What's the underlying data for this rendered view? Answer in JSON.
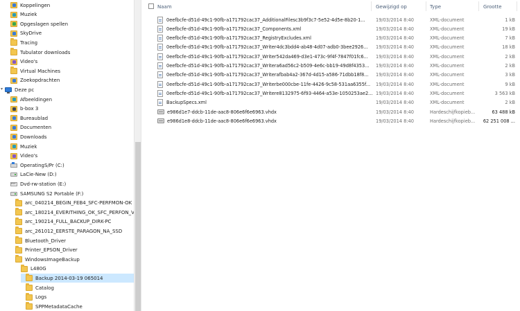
{
  "navigation": {
    "items": [
      {
        "label": "Koppelingen",
        "icon": "links-folder-icon",
        "kind": "special",
        "tint": ""
      },
      {
        "label": "Muziek",
        "icon": "music-folder-icon",
        "kind": "special",
        "tint": "ic-teal"
      },
      {
        "label": "Opgeslagen spellen",
        "icon": "saved-games-folder-icon",
        "kind": "special",
        "tint": "ic-green"
      },
      {
        "label": "SkyDrive",
        "icon": "skydrive-folder-icon",
        "kind": "special",
        "tint": ""
      },
      {
        "label": "Tracing",
        "icon": "folder-icon",
        "kind": "folder",
        "tint": ""
      },
      {
        "label": "Tubulator downloads",
        "icon": "folder-icon",
        "kind": "folder",
        "tint": ""
      },
      {
        "label": "Video's",
        "icon": "videos-folder-icon",
        "kind": "special",
        "tint": "ic-purple"
      },
      {
        "label": "Virtual Machines",
        "icon": "folder-icon",
        "kind": "folder",
        "tint": ""
      },
      {
        "label": "Zoekopdrachten",
        "icon": "searches-folder-icon",
        "kind": "special",
        "tint": ""
      },
      {
        "label": "Deze pc",
        "icon": "this-pc-icon",
        "kind": "pc",
        "tint": ""
      },
      {
        "label": "Afbeeldingen",
        "icon": "pictures-folder-icon",
        "kind": "special",
        "tint": "ic-teal"
      },
      {
        "label": "b-box 3",
        "icon": "network-folder-icon",
        "kind": "special",
        "tint": "ic-dark"
      },
      {
        "label": "Bureaublad",
        "icon": "desktop-folder-icon",
        "kind": "special",
        "tint": ""
      },
      {
        "label": "Documenten",
        "icon": "documents-folder-icon",
        "kind": "special",
        "tint": ""
      },
      {
        "label": "Downloads",
        "icon": "downloads-folder-icon",
        "kind": "special",
        "tint": ""
      },
      {
        "label": "Muziek",
        "icon": "music-folder-icon",
        "kind": "special",
        "tint": "ic-teal"
      },
      {
        "label": "Video's",
        "icon": "videos-folder-icon",
        "kind": "special",
        "tint": "ic-purple"
      },
      {
        "label": "OperatingS/Pr (C:)",
        "icon": "windows-drive-icon",
        "kind": "win",
        "tint": ""
      },
      {
        "label": "LaCie-New (D:)",
        "icon": "drive-icon",
        "kind": "drive",
        "tint": ""
      },
      {
        "label": "Dvd-rw-station (E:)",
        "icon": "dvd-drive-icon",
        "kind": "dvd",
        "tint": ""
      },
      {
        "label": "SAMSUNG S2 Portable (F:)",
        "icon": "drive-icon",
        "kind": "drive",
        "tint": ""
      },
      {
        "label": "arc_040214_BEGIN_FEB4_SFC-PERFMON-OK",
        "icon": "folder-icon",
        "kind": "folder",
        "tint": ""
      },
      {
        "label": "arc_180214_EVERITHING_OK_SFC_PERFON_VIR",
        "icon": "folder-icon",
        "kind": "folder",
        "tint": ""
      },
      {
        "label": "arc_190214_FULL_BACKUP_DIRK-PC",
        "icon": "folder-icon",
        "kind": "folder",
        "tint": ""
      },
      {
        "label": "arc_261012_EERSTE_PARAGON_NA_SSD",
        "icon": "folder-icon",
        "kind": "folder",
        "tint": ""
      },
      {
        "label": "Bluetooth_Driver",
        "icon": "folder-icon",
        "kind": "folder",
        "tint": ""
      },
      {
        "label": "Printer_EPSON_Driver",
        "icon": "folder-icon",
        "kind": "folder",
        "tint": ""
      },
      {
        "label": "WindowsImageBackup",
        "icon": "folder-icon",
        "kind": "folder",
        "tint": ""
      },
      {
        "label": "L480G",
        "icon": "folder-icon",
        "kind": "folder",
        "tint": ""
      },
      {
        "label": "Backup 2014-03-19 065014",
        "icon": "folder-icon",
        "kind": "folder",
        "tint": "",
        "selected": true
      },
      {
        "label": "Catalog",
        "icon": "folder-icon",
        "kind": "folder",
        "tint": ""
      },
      {
        "label": "Logs",
        "icon": "folder-icon",
        "kind": "folder",
        "tint": ""
      },
      {
        "label": "SPPMetadataCache",
        "icon": "folder-icon",
        "kind": "folder",
        "tint": ""
      }
    ]
  },
  "file_list": {
    "columns": {
      "name": "Naam",
      "date": "Gewijzigd op",
      "type": "Type",
      "size": "Grootte"
    },
    "rows": [
      {
        "name": "0eefbcfe-d51d-49c1-90fb-a171792cac37_AdditionalFilesc3b9f3c7-5e52-4d5e-8b20-1...",
        "date": "19/03/2014 8:40",
        "type": "XML-document",
        "size": "1 kB",
        "icon": "xml-file-icon"
      },
      {
        "name": "0eefbcfe-d51d-49c1-90fb-a171792cac37_Components.xml",
        "date": "19/03/2014 8:40",
        "type": "XML-document",
        "size": "19 kB",
        "icon": "xml-file-icon"
      },
      {
        "name": "0eefbcfe-d51d-49c1-90fb-a171792cac37_RegistryExcludes.xml",
        "date": "19/03/2014 8:40",
        "type": "XML-document",
        "size": "7 kB",
        "icon": "xml-file-icon"
      },
      {
        "name": "0eefbcfe-d51d-49c1-90fb-a171792cac37_Writer4dc3bdd4-ab48-4d07-adb0-3bee2926...",
        "date": "19/03/2014 8:40",
        "type": "XML-document",
        "size": "18 kB",
        "icon": "xml-file-icon"
      },
      {
        "name": "0eefbcfe-d51d-49c1-90fb-a171792cac37_Writer542da469-d3e1-473c-9f4f-7847f01fc6...",
        "date": "19/03/2014 8:40",
        "type": "XML-document",
        "size": "2 kB",
        "icon": "xml-file-icon"
      },
      {
        "name": "0eefbcfe-d51d-49c1-90fb-a171792cac37_Writera6ad56c2-b509-4e6c-bb19-49d8f4353...",
        "date": "19/03/2014 8:40",
        "type": "XML-document",
        "size": "2 kB",
        "icon": "xml-file-icon"
      },
      {
        "name": "0eefbcfe-d51d-49c1-90fb-a171792cac37_Writerafbab4a2-367d-4d15-a586-71dbb18f8...",
        "date": "19/03/2014 8:40",
        "type": "XML-document",
        "size": "3 kB",
        "icon": "xml-file-icon"
      },
      {
        "name": "0eefbcfe-d51d-49c1-90fb-a171792cac37_Writerbe000cbe-11fe-4426-9c58-531aa6355f...",
        "date": "19/03/2014 8:40",
        "type": "XML-document",
        "size": "9 kB",
        "icon": "xml-file-icon"
      },
      {
        "name": "0eefbcfe-d51d-49c1-90fb-a171792cac37_Writere8132975-6f93-4464-a53e-1050253ae2...",
        "date": "19/03/2014 8:40",
        "type": "XML-document",
        "size": "3 563 kB",
        "icon": "xml-file-icon"
      },
      {
        "name": "BackupSpecs.xml",
        "date": "19/03/2014 8:40",
        "type": "XML-document",
        "size": "2 kB",
        "icon": "xml-file-icon"
      },
      {
        "name": "e986d1e7-ddcb-11de-aac8-806e6f6e6963.vhdx",
        "date": "19/03/2014 8:40",
        "type": "Hardeschijfkopieb...",
        "size": "63 488 kB",
        "icon": "vhdx-disk-icon"
      },
      {
        "name": "e986d1e8-ddcb-11de-aac8-806e6f6e6963.vhdx",
        "date": "19/03/2014 8:40",
        "type": "Hardeschijfkopieb...",
        "size": "62 251 008 ...",
        "icon": "vhdx-disk-icon"
      }
    ]
  }
}
